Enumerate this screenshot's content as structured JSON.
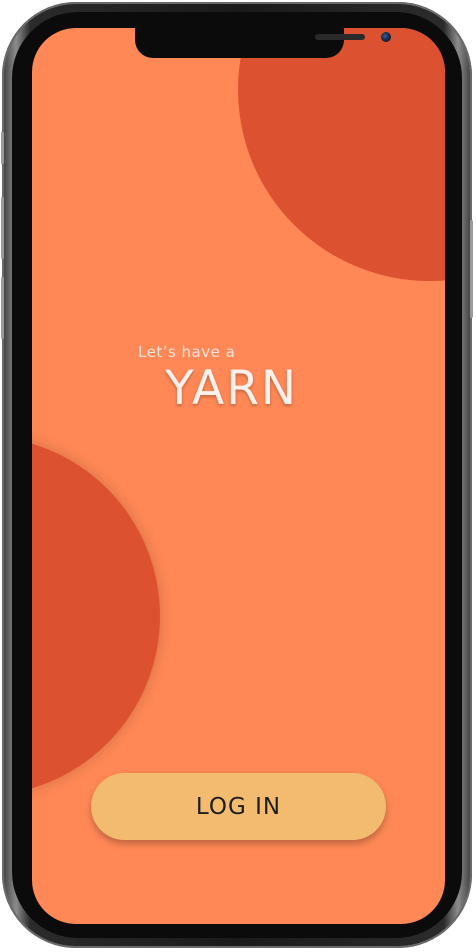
{
  "app": {
    "tagline": "Let’s have a",
    "brand": "YARN"
  },
  "actions": {
    "login_label": "LOG IN"
  },
  "colors": {
    "background": "#ff8856",
    "accent_shape": "#dc5230",
    "button": "#f3bb70",
    "text_light": "#fbf1ec",
    "button_text": "#1e1e1e"
  }
}
